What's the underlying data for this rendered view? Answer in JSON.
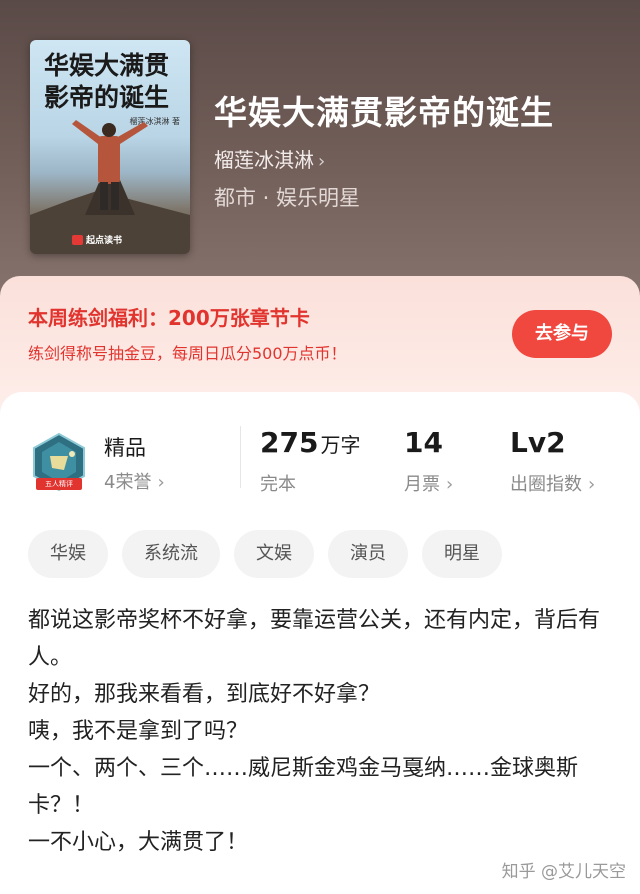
{
  "book": {
    "cover_title": "华娱大满贯影帝的诞生",
    "cover_author": "榴莲冰淇淋 著",
    "cover_publisher": "起点读书",
    "title": "华娱大满贯影帝的诞生",
    "author": "榴莲冰淇淋",
    "genre": "都市 · 娱乐明星"
  },
  "promo": {
    "title": "本周练剑福利：200万张章节卡",
    "subtitle": "练剑得称号抽金豆，每周日瓜分500万点币！",
    "button": "去参与"
  },
  "stats": {
    "quality_label": "精品",
    "honors": "4荣誉",
    "words_value": "275",
    "words_unit": "万字",
    "status": "完本",
    "monthly_votes_value": "14",
    "monthly_votes_label": "月票",
    "level_value": "Lv2",
    "level_label": "出圈指数"
  },
  "tags": [
    "华娱",
    "系统流",
    "文娱",
    "演员",
    "明星"
  ],
  "intro": [
    "都说这影帝奖杯不好拿，要靠运营公关，还有内定，背后有人。",
    "好的，那我来看看，到底好不好拿？",
    "咦，我不是拿到了吗？",
    "一个、两个、三个……威尼斯金鸡金马戛纳……金球奥斯卡？！",
    "一不小心，大满贯了！"
  ],
  "watermark": "知乎 @艾儿天空",
  "colors": {
    "accent_red": "#e2342f",
    "button_red": "#f0473f",
    "hero_bg": "#6e5b56"
  }
}
